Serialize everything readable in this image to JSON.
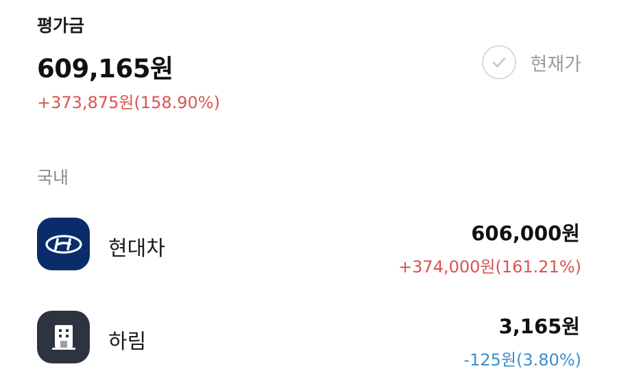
{
  "summary": {
    "label": "평가금",
    "total": "609,165원",
    "change": "+373,875원(158.90%)"
  },
  "toggle": {
    "label": "현재가",
    "icon": "check-icon"
  },
  "section": {
    "title": "국내"
  },
  "holdings": [
    {
      "name": "현대차",
      "value": "606,000원",
      "change": "+374,000원(161.21%)",
      "direction": "up",
      "logo_icon": "hyundai-logo-icon",
      "logo_bg": "#0b2c6b"
    },
    {
      "name": "하림",
      "value": "3,165원",
      "change": "-125원(3.80%)",
      "direction": "down",
      "logo_icon": "building-icon",
      "logo_bg": "#2c3440"
    }
  ],
  "colors": {
    "up": "#d9534f",
    "down": "#3a8fc8"
  }
}
